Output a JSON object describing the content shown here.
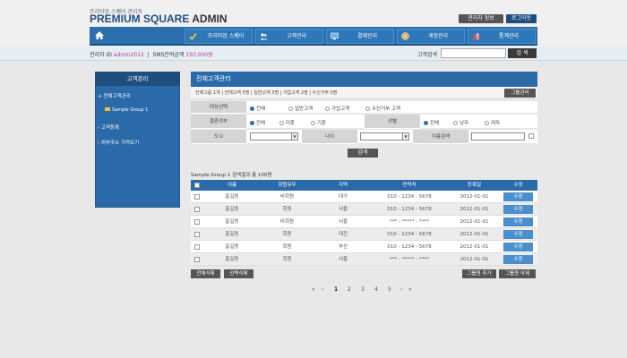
{
  "brand": {
    "sub": "프리미엄 스퀘어 관리자",
    "title_main": "PREMIUM SQUARE",
    "title_admin": "ADMIN"
  },
  "top_buttons": {
    "info": "관리자 정보",
    "logout": "로그아웃"
  },
  "nav": {
    "items": [
      {
        "label": "프리미엄 스퀘어",
        "icon": "check-icon",
        "color": "#f1c232"
      },
      {
        "label": "고객관리",
        "icon": "people-icon",
        "color": "#2e78ba"
      },
      {
        "label": "결제관리",
        "icon": "monitor-icon",
        "color": "#6fb3e8"
      },
      {
        "label": "게정관리",
        "icon": "coin-icon",
        "color": "#e8a84a"
      },
      {
        "label": "통계관리",
        "icon": "building-icon",
        "color": "#c65a5a"
      }
    ]
  },
  "info": {
    "admin_label": "관리자 ID",
    "admin_id": "admin2012",
    "sms_label": "SMS잔여금액",
    "sms_value": "150,000원",
    "search_label": "고객검색",
    "search_button": "검 색"
  },
  "sidebar": {
    "title": "고객관리",
    "items": [
      {
        "label": "전체고객관리",
        "bullet": "+"
      },
      {
        "label": "Sample Group 1",
        "bullet": "folder"
      },
      {
        "label": "고객등록",
        "bullet": "›"
      },
      {
        "label": "외부주소 가져오기",
        "bullet": "›"
      }
    ]
  },
  "panel": {
    "title": "전체고객관리"
  },
  "summary": {
    "text": "전체그룹 1개 | 전체고객 5명 | 일반고객 3명 | 가입고객 2명 | 수신거부 0명",
    "group_button": "그룹관리"
  },
  "filters": {
    "target_label": "대상선택",
    "target_options": [
      "전체",
      "일반고객",
      "가입고객",
      "수신거부 고객"
    ],
    "married_label": "결혼여부",
    "married_options": [
      "전체",
      "미혼",
      "기혼"
    ],
    "gender_label": "성별",
    "gender_options": [
      "전체",
      "남자",
      "여자"
    ],
    "city_label": "도시",
    "age_label": "나이",
    "name_label": "이름검색",
    "search_button": "검색"
  },
  "results": {
    "title": "Sample Group 1",
    "title_suffix": "검색결과 총 100명",
    "headers": [
      "이름",
      "회원유무",
      "지역",
      "연락처",
      "등록일",
      "수정"
    ],
    "rows": [
      {
        "name": "홍길동",
        "member": "비회원",
        "region": "대구",
        "phone": "010 - 1234 - 5678",
        "date": "2012-01-01",
        "edit": "수정"
      },
      {
        "name": "홍길동",
        "member": "회원",
        "region": "서울",
        "phone": "010 - 1234 - 5678",
        "date": "2012-01-01",
        "edit": "수정"
      },
      {
        "name": "홍길동",
        "member": "비회원",
        "region": "서울",
        "phone": "*** - ***** - ****",
        "date": "2012-01-01",
        "edit": "수정"
      },
      {
        "name": "홍길동",
        "member": "회원",
        "region": "대전",
        "phone": "010 - 1234 - 5678",
        "date": "2012-01-01",
        "edit": "수정"
      },
      {
        "name": "홍길동",
        "member": "회원",
        "region": "부산",
        "phone": "010 - 1234 - 5678",
        "date": "2012-01-01",
        "edit": "수정"
      },
      {
        "name": "홍길동",
        "member": "회원",
        "region": "서울",
        "phone": "*** - ***** - ****",
        "date": "2012-01-01",
        "edit": "수정"
      }
    ]
  },
  "bottom_buttons": {
    "delete_all": "전체삭제",
    "delete_selected": "선택삭제",
    "add_group": "그룹원 추가",
    "delete_group": "그룹원 삭제"
  },
  "pager": {
    "first": "«",
    "prev": "‹",
    "pages": [
      "1",
      "2",
      "3",
      "4",
      "5"
    ],
    "next": "›",
    "last": "»"
  }
}
